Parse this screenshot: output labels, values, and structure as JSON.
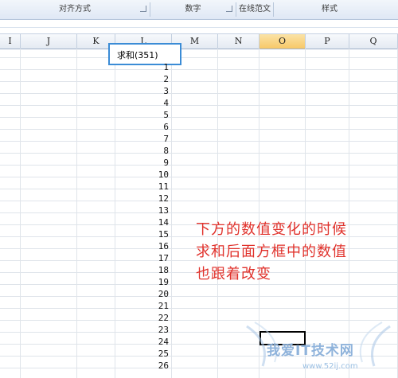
{
  "ribbon": {
    "groups": [
      {
        "label": "对齐方式",
        "launcher": true
      },
      {
        "label": "数字",
        "launcher": true
      },
      {
        "label": "在线范文",
        "launcher": false
      },
      {
        "label": "样式",
        "launcher": false
      }
    ]
  },
  "columns": [
    "I",
    "J",
    "K",
    "L",
    "M",
    "N",
    "O",
    "P",
    "Q"
  ],
  "selected_column": "O",
  "cells": {
    "sum_label": "求和(351)",
    "values": [
      "1",
      "2",
      "3",
      "4",
      "5",
      "6",
      "7",
      "8",
      "9",
      "10",
      "11",
      "12",
      "13",
      "14",
      "15",
      "16",
      "17",
      "18",
      "19",
      "20",
      "21",
      "22",
      "23",
      "24",
      "25",
      "26"
    ]
  },
  "annotation": {
    "lines": [
      "下方的数值变化的时候",
      "求和后面方框中的数值",
      "也跟着改变"
    ]
  },
  "watermark": {
    "text": "我爱IT技术网",
    "url": "www.52ij.com"
  },
  "colors": {
    "annotation": "#e0312b",
    "highlight_box": "#3b8cd6",
    "selected_header": "#f7c868"
  }
}
